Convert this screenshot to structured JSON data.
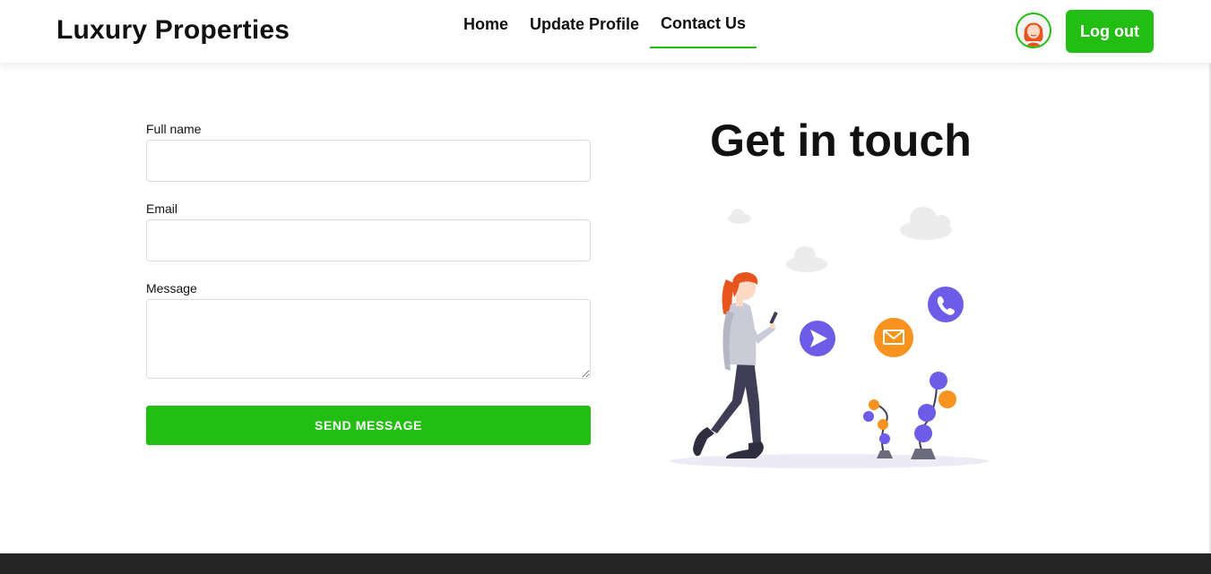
{
  "header": {
    "brand": "Luxury Properties",
    "nav": [
      {
        "label": "Home",
        "active": false
      },
      {
        "label": "Update Profile",
        "active": false
      },
      {
        "label": "Contact Us",
        "active": true
      }
    ],
    "logout_label": "Log out"
  },
  "form": {
    "full_name_label": "Full name",
    "full_name_value": "",
    "email_label": "Email",
    "email_value": "",
    "message_label": "Message",
    "message_value": "",
    "submit_label": "SEND MESSAGE"
  },
  "contact": {
    "heading": "Get in touch"
  },
  "colors": {
    "accent": "#22bf12",
    "illustration_purple": "#6c5ce7",
    "illustration_orange": "#f7931e",
    "footer": "#252525"
  },
  "icons": [
    "user-avatar",
    "send-icon",
    "mail-icon",
    "phone-icon"
  ]
}
